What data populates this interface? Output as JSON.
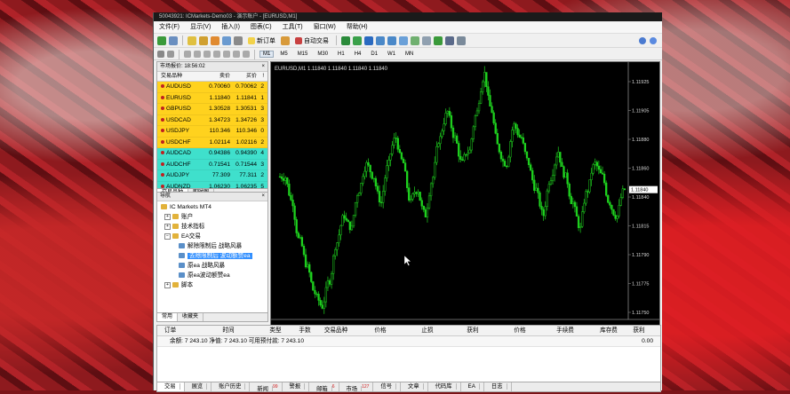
{
  "window": {
    "title": "50043921: ICMarkets-Demo03 - 演示账户 - [EURUSD,M1]",
    "controls": [
      "_",
      "□",
      "×"
    ]
  },
  "menu": [
    "文件(F)",
    "显示(V)",
    "插入(I)",
    "图表(C)",
    "工具(T)",
    "窗口(W)",
    "帮助(H)"
  ],
  "toolbar": {
    "new_order": "新订单",
    "auto_trade": "自动交易",
    "timeframes": [
      "M1",
      "M5",
      "M15",
      "M30",
      "H1",
      "H4",
      "D1",
      "W1",
      "MN"
    ],
    "active_timeframe": "M1"
  },
  "market_watch": {
    "title": "市场报价: 18:56:02",
    "columns": [
      "交易品种",
      "卖价",
      "买价",
      "!"
    ],
    "rows": [
      {
        "symbol": "AUDUSD",
        "bid": "0.70060",
        "ask": "0.70062",
        "spread": "2",
        "color": "#ffd21e"
      },
      {
        "symbol": "EURUSD",
        "bid": "1.11840",
        "ask": "1.11841",
        "spread": "1",
        "color": "#ffd21e"
      },
      {
        "symbol": "GBPUSD",
        "bid": "1.30528",
        "ask": "1.30531",
        "spread": "3",
        "color": "#ffd21e"
      },
      {
        "symbol": "USDCAD",
        "bid": "1.34723",
        "ask": "1.34726",
        "spread": "3",
        "color": "#ffd21e"
      },
      {
        "symbol": "USDJPY",
        "bid": "110.346",
        "ask": "110.346",
        "spread": "0",
        "color": "#ffd21e"
      },
      {
        "symbol": "USDCHF",
        "bid": "1.02114",
        "ask": "1.02116",
        "spread": "2",
        "color": "#ffd21e"
      },
      {
        "symbol": "AUDCAD",
        "bid": "0.94386",
        "ask": "0.94390",
        "spread": "4",
        "color": "#3fe0cc"
      },
      {
        "symbol": "AUDCHF",
        "bid": "0.71541",
        "ask": "0.71544",
        "spread": "3",
        "color": "#3fe0cc"
      },
      {
        "symbol": "AUDJPY",
        "bid": "77.309",
        "ask": "77.311",
        "spread": "2",
        "color": "#3fe0cc"
      },
      {
        "symbol": "AUDNZD",
        "bid": "1.06230",
        "ask": "1.06235",
        "spread": "5",
        "color": "#3fe0cc"
      }
    ],
    "tabs": [
      "交易品种",
      "即时图"
    ]
  },
  "navigator": {
    "title": "导航",
    "root": "IC Markets MT4",
    "folders": [
      "账户",
      "技术指标",
      "EA交易"
    ],
    "ea_items": [
      "解除限制后 战略风暴",
      "去除限制后 波动额赞ea",
      "原ea 战略风暴",
      "原ea波动额赞ea"
    ],
    "selected_index": 1,
    "scripts": "脚本",
    "tabs": [
      "常用",
      "收藏夹"
    ]
  },
  "chart_data": {
    "type": "candlestick",
    "title": "EURUSD,M1 1.11840 1.11840 1.11840 1.11840",
    "y_ticks": [
      "1.11925",
      "1.11905",
      "1.11880",
      "1.11860",
      "1.11840",
      "1.11815",
      "1.11790",
      "1.11775",
      "1.11750",
      "1.11820",
      "1.11835",
      "1.11865",
      "1.11890",
      "1.11910"
    ],
    "y_axis_labels": [
      "1.11925",
      "1.11905",
      "1.11880",
      "1.11860",
      "1.11840",
      "1.11815",
      "1.11790",
      "1.11775",
      "1.11750"
    ],
    "ylim": [
      1.1174,
      1.1193
    ],
    "current_price": "1.11840",
    "x_ticks": [
      "7 May 2019",
      "7 May 16:07",
      "7 May 16:23",
      "7 May 16:39",
      "7 May 16:55",
      "7 May 17:11",
      "7 May 17:27",
      "7 May 17:43",
      "7 May 17:59",
      "7 May 18:15",
      "7 May 18:31",
      "7 May 18:47"
    ],
    "bar_color": "#1fd21f",
    "closes": [
      1.1185,
      1.1183,
      1.118,
      1.1178,
      1.1176,
      1.1175,
      1.1177,
      1.118,
      1.1182,
      1.1181,
      1.1184,
      1.1186,
      1.1185,
      1.1183,
      1.1186,
      1.1188,
      1.1186,
      1.1183,
      1.1184,
      1.1182,
      1.1185,
      1.1188,
      1.119,
      1.1188,
      1.1186,
      1.1187,
      1.119,
      1.1193,
      1.119,
      1.1187,
      1.1186,
      1.1189,
      1.1188,
      1.1186,
      1.1184,
      1.1182,
      1.1185,
      1.1187,
      1.1185,
      1.1183,
      1.1181,
      1.1184,
      1.1186,
      1.1185,
      1.1183,
      1.1182,
      1.1184
    ]
  },
  "terminal": {
    "columns": [
      "订单",
      "时间",
      "类型",
      "手数",
      "交易品种",
      "价格",
      "止损",
      "获利",
      "价格",
      "手续费",
      "库存费",
      "获利"
    ],
    "balance_line": "余额: 7 243.10  净值: 7 243.10  可用预付款: 7 243.10",
    "balance_value": "0.00",
    "tabs": [
      {
        "label": "交易",
        "badge": ""
      },
      {
        "label": "展览",
        "badge": ""
      },
      {
        "label": "账户历史",
        "badge": ""
      },
      {
        "label": "新闻",
        "badge": "99"
      },
      {
        "label": "警报",
        "badge": ""
      },
      {
        "label": "邮箱",
        "badge": "6"
      },
      {
        "label": "市场",
        "badge": "127"
      },
      {
        "label": "信号",
        "badge": ""
      },
      {
        "label": "文章",
        "badge": ""
      },
      {
        "label": "代码库",
        "badge": ""
      },
      {
        "label": "EA",
        "badge": ""
      },
      {
        "label": "日志",
        "badge": ""
      }
    ]
  }
}
